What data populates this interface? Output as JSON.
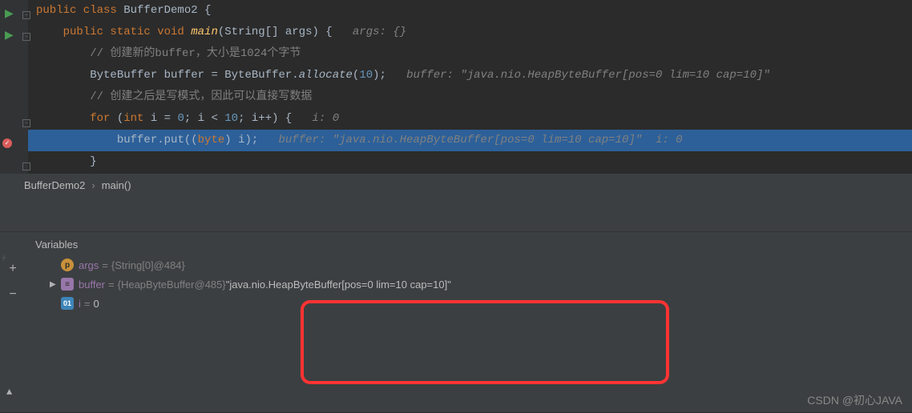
{
  "code": {
    "l1": {
      "kw1": "public class ",
      "cls": "BufferDemo2 ",
      "brace": "{"
    },
    "l2": {
      "kw1": "public static void ",
      "fn": "main",
      "paren1": "(",
      "type": "String",
      "arr": "[] args) {   ",
      "hint": "args: {}"
    },
    "l3": {
      "cmt": "// 创建新的buffer，大小是1024个字节"
    },
    "l4": {
      "type": "ByteBuffer ",
      "var": "buffer = ByteBuffer",
      "dot": ".",
      "fn": "allocate",
      "paren": "(",
      "num": "10",
      "end": ");   ",
      "hint": "buffer: \"java.nio.HeapByteBuffer[pos=0 lim=10 cap=10]\""
    },
    "l5": {
      "cmt": "// 创建之后是写模式，因此可以直接写数据"
    },
    "l6": {
      "kw": "for ",
      "paren": "(",
      "kw2": "int ",
      "var": "i = ",
      "num1": "0",
      "semi": "; i < ",
      "num2": "10",
      "semi2": "; i++) {   ",
      "hint": "i: 0"
    },
    "l7": {
      "var": "buffer.put((",
      "kw": "byte",
      "cast": ") i);   ",
      "hint": "buffer: \"java.nio.HeapByteBuffer[pos=0 lim=10 cap=10]\"  i: 0"
    },
    "l8": {
      "brace": "}"
    }
  },
  "breadcrumb": {
    "cls": "BufferDemo2",
    "method": "main()"
  },
  "debug": {
    "title": "Variables",
    "vars": {
      "args": {
        "name": "args",
        "type": "{String[0]@484}"
      },
      "buffer": {
        "name": "buffer",
        "type": "{HeapByteBuffer@485}",
        "val": "\"java.nio.HeapByteBuffer[pos=0 lim=10 cap=10]\""
      },
      "i": {
        "name": "i",
        "val": "0"
      }
    }
  },
  "watermark": "CSDN @初心JAVA"
}
